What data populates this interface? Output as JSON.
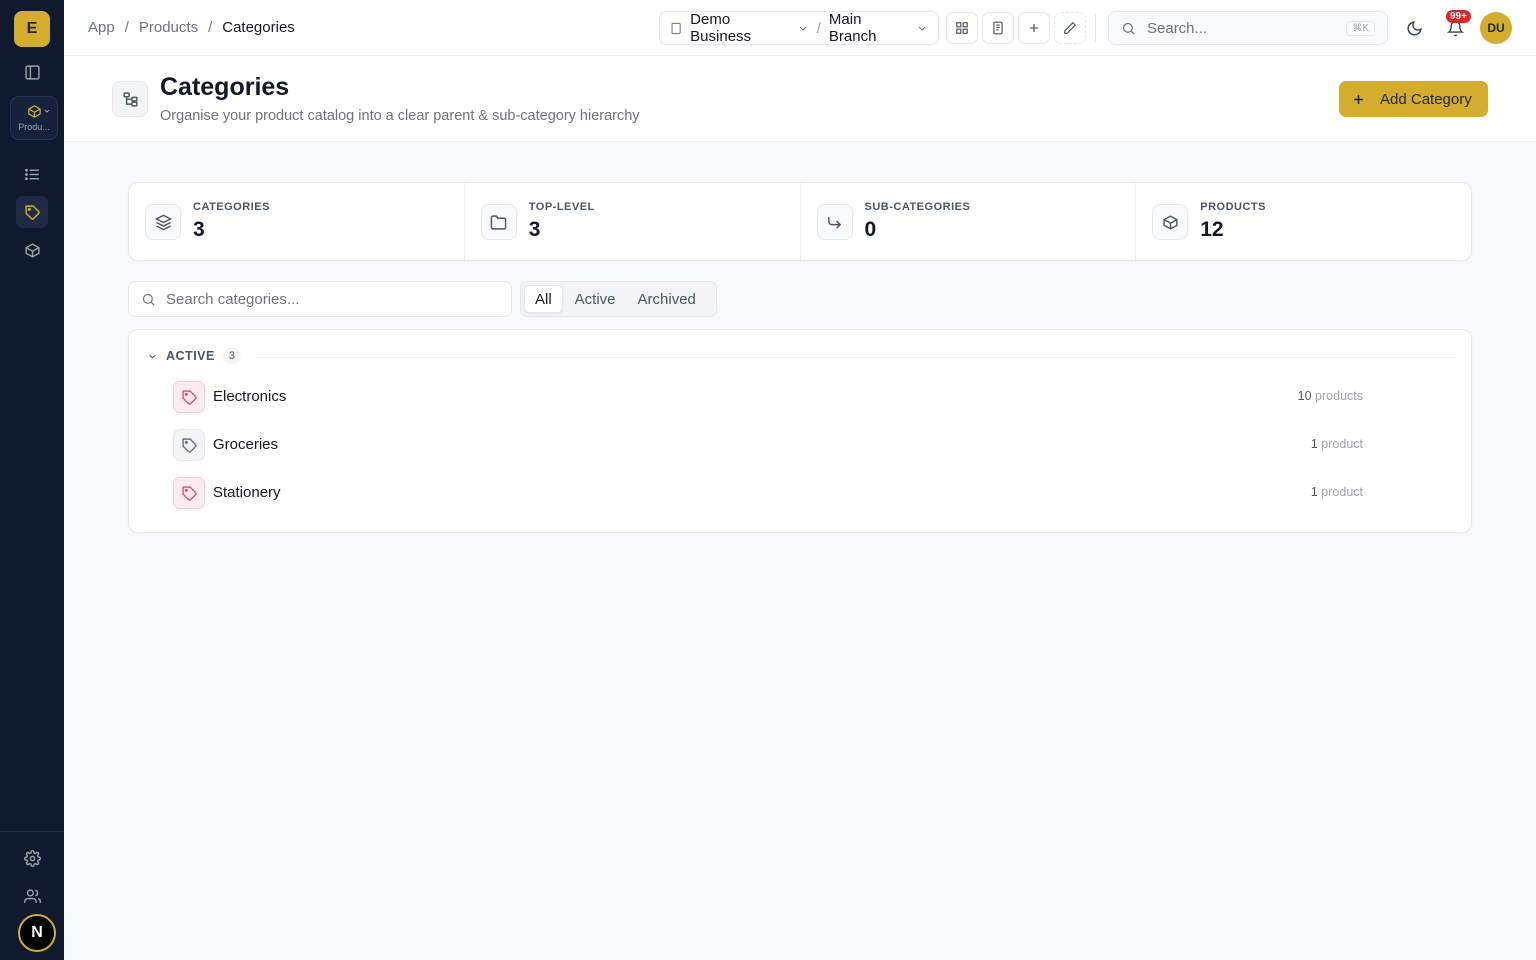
{
  "sidebar": {
    "logo_letter": "E",
    "module_label": "Produ...",
    "avatar_letter": "N"
  },
  "topbar": {
    "breadcrumb": [
      "App",
      "Products",
      "Categories"
    ],
    "business": "Demo Business",
    "branch": "Main Branch",
    "search_placeholder": "Search...",
    "search_shortcut": "⌘K",
    "notifications_badge": "99+",
    "user_initials": "DU"
  },
  "page": {
    "title": "Categories",
    "subtitle": "Organise your product catalog into a clear parent & sub-category hierarchy",
    "add_button": "Add Category"
  },
  "stats": [
    {
      "label": "CATEGORIES",
      "value": "3",
      "icon": "layers-icon"
    },
    {
      "label": "TOP-LEVEL",
      "value": "3",
      "icon": "folder-icon"
    },
    {
      "label": "SUB-CATEGORIES",
      "value": "0",
      "icon": "corner-down-right-icon"
    },
    {
      "label": "PRODUCTS",
      "value": "12",
      "icon": "package-icon"
    }
  ],
  "filters": {
    "search_placeholder": "Search categories...",
    "tabs": [
      "All",
      "Active",
      "Archived"
    ],
    "selected_tab": "All"
  },
  "groups": [
    {
      "label": "ACTIVE",
      "count": "3",
      "items": [
        {
          "name": "Electronics",
          "count": "10",
          "unit": "products",
          "icon_color": "pink"
        },
        {
          "name": "Groceries",
          "count": "1",
          "unit": "product",
          "icon_color": "gray"
        },
        {
          "name": "Stationery",
          "count": "1",
          "unit": "product",
          "icon_color": "pink"
        }
      ]
    }
  ],
  "colors": {
    "accent": "#d4ad2e",
    "sidebar_bg": "#0f1a2e",
    "tag_pink": "#e05283",
    "badge_red": "#dc2626"
  }
}
